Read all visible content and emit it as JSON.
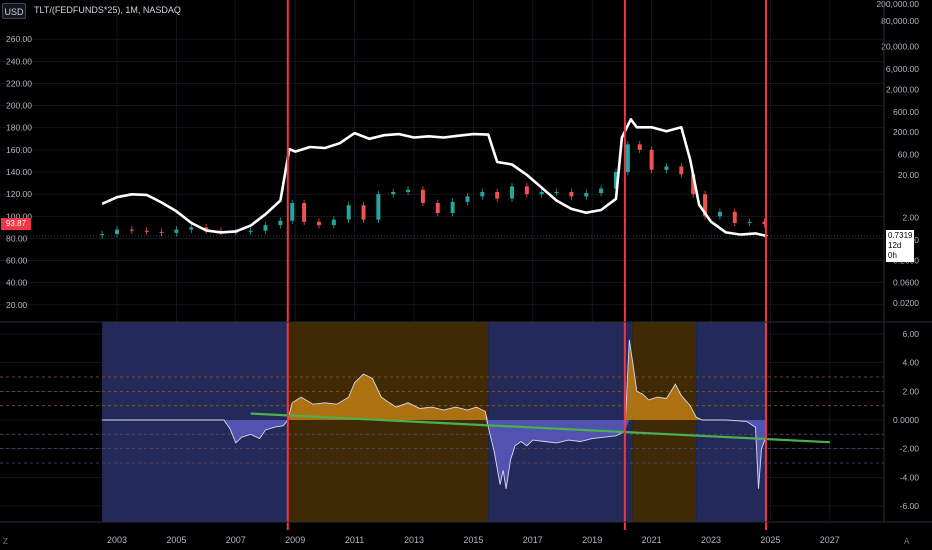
{
  "header": {
    "currency_button": "USD",
    "symbol": "TLT/(FEDFUNDS*25), 1M, NASDAQ"
  },
  "badges": {
    "left_price": "93.87",
    "right_value": "0.7319",
    "right_countdown": "12d 0h"
  },
  "corners": {
    "left": "Z",
    "right": "A"
  },
  "colors": {
    "background": "#000000",
    "grid": "#1e222d",
    "tlt_up": "#26a69a",
    "tlt_down": "#ef5350",
    "ratio_line": "#ffffff",
    "red_vline": "#f23645",
    "blue_zone": "#232a5a",
    "orange_zone": "#3f2a05",
    "hist_pos": "#b87a14",
    "hist_neg": "#5b5bc0",
    "trendline": "#4caf50",
    "dashed_orange": "#8a5a1a"
  },
  "chart_data": [
    {
      "type": "line",
      "title": "TLT/(FEDFUNDS*25), 1M, NASDAQ",
      "xlabel": "",
      "ylabel": "",
      "x_ticks": [
        "2003",
        "2005",
        "2007",
        "2009",
        "2011",
        "2013",
        "2015",
        "2017",
        "2019",
        "2021",
        "2023",
        "2025",
        "2027"
      ],
      "xlim": [
        2002.0,
        2029.0
      ],
      "y_left_ticks": [
        "20.00",
        "40.00",
        "60.00",
        "80.00",
        "100.00",
        "120.00",
        "140.00",
        "160.00",
        "180.00",
        "200.00",
        "220.00",
        "240.00",
        "260.00"
      ],
      "y_left_lim": [
        0,
        280
      ],
      "y_right_ticks": [
        "0.0200",
        "0.0600",
        "0.2000",
        "0.6000",
        "2.00",
        "20.00",
        "60.00",
        "200.00",
        "600.00",
        "2,000.00",
        "6,000.00",
        "20,000.00",
        "80,000.00",
        "200,000.00"
      ],
      "y_right_scale": "log",
      "series": [
        {
          "name": "",
          "kind": "candles",
          "axis": "left",
          "x": [
            2002.5,
            2003.0,
            2003.5,
            2004.0,
            2004.5,
            2005.0,
            2005.5,
            2006.0,
            2006.5,
            2007.0,
            2007.5,
            2008.0,
            2008.5,
            2008.9,
            2009.3,
            2009.8,
            2010.3,
            2010.8,
            2011.3,
            2011.8,
            2012.3,
            2012.8,
            2013.3,
            2013.8,
            2014.3,
            2014.8,
            2015.3,
            2015.8,
            2016.3,
            2016.8,
            2017.3,
            2017.8,
            2018.3,
            2018.8,
            2019.3,
            2019.8,
            2020.2,
            2020.6,
            2021.0,
            2021.5,
            2022.0,
            2022.4,
            2022.8,
            2023.3,
            2023.8,
            2024.3,
            2024.8
          ],
          "values": [
            84,
            88,
            87,
            86,
            85,
            88,
            90,
            87,
            86,
            86,
            87,
            92,
            96,
            112,
            95,
            92,
            97,
            110,
            97,
            120,
            122,
            124,
            112,
            103,
            113,
            118,
            122,
            116,
            127,
            120,
            122,
            122,
            118,
            121,
            125,
            140,
            165,
            160,
            142,
            145,
            138,
            120,
            100,
            104,
            94,
            95,
            93
          ]
        },
        {
          "name": "",
          "kind": "line",
          "axis": "right",
          "x": [
            2002.5,
            2003.0,
            2003.5,
            2004.0,
            2004.5,
            2005.0,
            2005.5,
            2006.0,
            2006.5,
            2007.0,
            2007.5,
            2008.0,
            2008.5,
            2008.8,
            2009.0,
            2009.5,
            2010.0,
            2010.5,
            2011.0,
            2011.5,
            2012.0,
            2012.5,
            2013.0,
            2013.5,
            2014.0,
            2014.5,
            2015.0,
            2015.5,
            2015.8,
            2016.3,
            2016.8,
            2017.3,
            2017.8,
            2018.3,
            2018.8,
            2019.3,
            2019.8,
            2020.0,
            2020.3,
            2020.5,
            2021.0,
            2021.5,
            2022.0,
            2022.3,
            2022.6,
            2023.0,
            2023.5,
            2024.0,
            2024.5,
            2024.9
          ],
          "values": [
            4.2,
            6.0,
            7.0,
            6.8,
            4.5,
            2.8,
            1.5,
            1.0,
            0.9,
            0.95,
            1.3,
            2.4,
            5.0,
            80,
            70,
            90,
            85,
            110,
            190,
            140,
            170,
            180,
            150,
            160,
            150,
            165,
            180,
            175,
            40,
            35,
            20,
            10,
            5.0,
            3.2,
            2.6,
            3.0,
            5.5,
            150,
            400,
            260,
            260,
            210,
            260,
            45,
            4.0,
            1.6,
            0.9,
            0.8,
            0.85,
            0.7319
          ]
        }
      ],
      "vertical_markers_x": [
        2008.75,
        2020.1,
        2024.85
      ]
    },
    {
      "type": "area",
      "title": "",
      "xlim": [
        2002.0,
        2029.0
      ],
      "y_ticks": [
        "6.00",
        "4.00",
        "2.00",
        "0.0000",
        "-2.00",
        "-4.00",
        "-6.00"
      ],
      "ylim": [
        -7.2,
        6.7
      ],
      "dashed_levels": [
        3.0,
        2.0,
        1.0,
        -1.0,
        -2.0,
        -3.0
      ],
      "zones": [
        {
          "from": 2002.5,
          "to": 2008.75,
          "type": "blue"
        },
        {
          "from": 2008.75,
          "to": 2015.5,
          "type": "orange"
        },
        {
          "from": 2015.5,
          "to": 2020.1,
          "type": "blue"
        },
        {
          "from": 2020.1,
          "to": 2020.35,
          "type": "blue"
        },
        {
          "from": 2020.35,
          "to": 2022.5,
          "type": "orange"
        },
        {
          "from": 2022.5,
          "to": 2024.85,
          "type": "blue"
        }
      ],
      "series": [
        {
          "name": "",
          "x": [
            2002.5,
            2006.6,
            2006.8,
            2007.0,
            2007.2,
            2007.5,
            2007.8,
            2008.0,
            2008.3,
            2008.6,
            2008.75,
            2008.9,
            2009.2,
            2009.6,
            2010.0,
            2010.4,
            2010.8,
            2011.0,
            2011.3,
            2011.6,
            2011.9,
            2012.1,
            2012.4,
            2012.8,
            2013.2,
            2013.6,
            2014.0,
            2014.4,
            2014.8,
            2015.1,
            2015.4,
            2015.5,
            2015.7,
            2015.9,
            2016.0,
            2016.1,
            2016.25,
            2016.4,
            2016.6,
            2016.8,
            2017.0,
            2017.4,
            2017.8,
            2018.2,
            2018.6,
            2019.0,
            2019.4,
            2019.8,
            2020.1,
            2020.25,
            2020.4,
            2020.5,
            2020.7,
            2020.9,
            2021.2,
            2021.5,
            2021.8,
            2022.0,
            2022.3,
            2022.5,
            2022.7,
            2023.5,
            2024.2,
            2024.5,
            2024.6,
            2024.7,
            2024.85
          ],
          "values": [
            0,
            0,
            -0.6,
            -1.6,
            -1.2,
            -1.0,
            -1.3,
            -0.7,
            -0.5,
            -0.4,
            0,
            1.2,
            1.6,
            1.1,
            1.2,
            1.1,
            1.6,
            2.6,
            3.2,
            2.9,
            1.6,
            1.3,
            0.9,
            1.2,
            0.8,
            0.9,
            0.7,
            0.9,
            0.7,
            0.9,
            0.6,
            -0.5,
            -2.2,
            -4.5,
            -3.5,
            -4.8,
            -2.8,
            -1.8,
            -1.5,
            -1.8,
            -1.4,
            -1.5,
            -1.6,
            -1.4,
            -1.5,
            -1.3,
            -1.2,
            -1.1,
            -0.8,
            5.6,
            3.5,
            2.0,
            1.8,
            1.4,
            1.6,
            1.5,
            2.5,
            1.7,
            1.0,
            0.2,
            0,
            0,
            -0.1,
            -0.5,
            -4.8,
            -2.0,
            -1.2
          ]
        }
      ],
      "trendline": {
        "x": [
          2007.5,
          2027.0
        ],
        "y": [
          0.45,
          -1.55
        ]
      }
    }
  ]
}
